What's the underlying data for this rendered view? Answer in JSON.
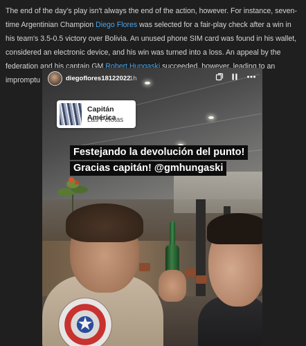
{
  "article": {
    "text_1": "The end of the day's play isn't always the end of the action, however. For instance, seven-time Argentinian Champion ",
    "link_1": "Diego Flores",
    "text_2": " was selected for a fair-play check after a win in his team's 3.5-0.5 victory over Bolivia. An unused phone SIM card was found in his wallet, considered an electronic device, and his win was turned into a loss. An appeal by the federation and his captain GM ",
    "link_2": "Robert Hungaski",
    "text_3": " succeeded, however, leading to an impromptu celebration!"
  },
  "story": {
    "username": "diegoflores18122022",
    "time": "1h",
    "icons": [
      "stack-icon",
      "pause-icon",
      "more-icon"
    ],
    "location": {
      "title": "Capitán América",
      "subtitle": "Las Pelotas"
    },
    "caption": {
      "line_1": "Festejando la devolución del punto!",
      "line_2": "Gracias capitán! @gmhungaski"
    }
  },
  "colors": {
    "link": "#4aa3e8",
    "background": "#1f1f1f"
  }
}
